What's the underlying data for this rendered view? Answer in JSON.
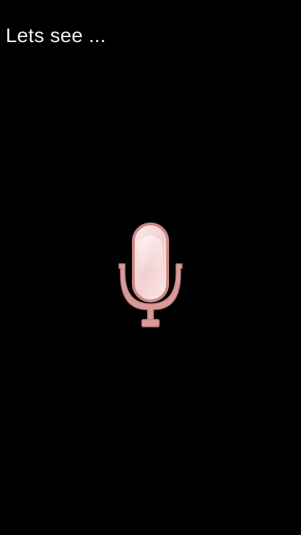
{
  "status": {
    "text": "Lets see ..."
  },
  "mic": {
    "icon": "microphone-icon",
    "fill_color": "#f8dcdc",
    "stroke_color": "#c98a8a"
  },
  "colors": {
    "background": "#000000",
    "text": "#f2f2f2"
  }
}
